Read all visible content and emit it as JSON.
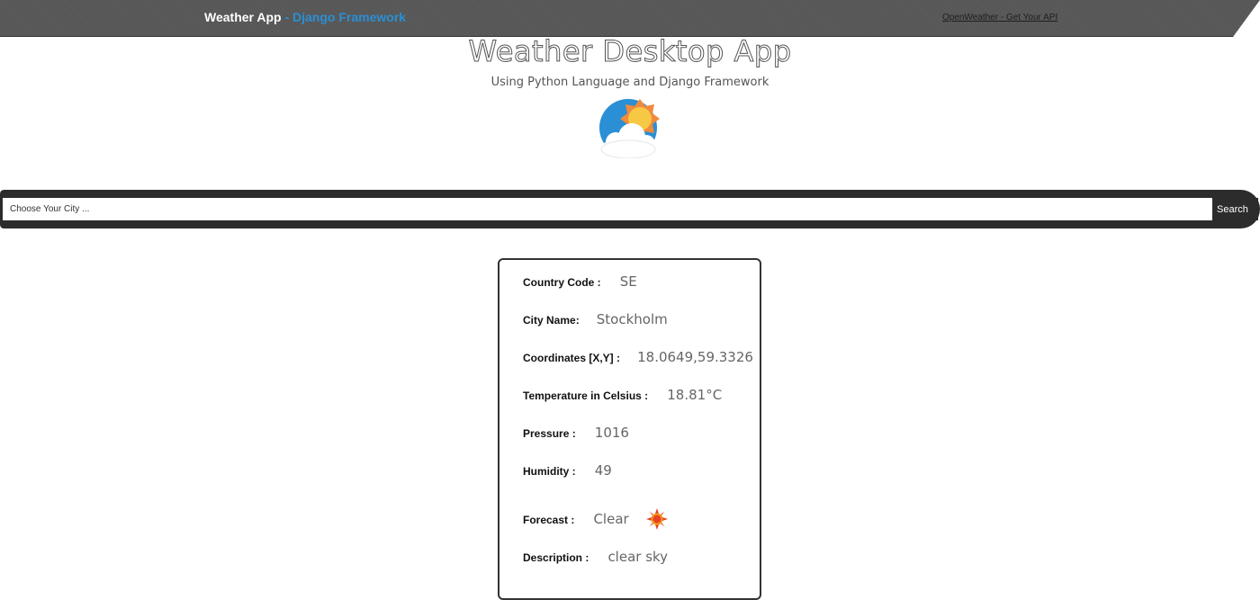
{
  "navbar": {
    "brand": "Weather App",
    "brand_accent": "- Django Framework",
    "api_link": "OpenWeather - Get Your API"
  },
  "header": {
    "title": "Weather Desktop App",
    "subtitle": "Using Python Language and Django Framework",
    "logo_icon": "sun-cloud-icon"
  },
  "search": {
    "placeholder": "Choose Your City ...",
    "value": "",
    "button_label": "Search"
  },
  "weather": {
    "country_code_label": "Country Code :",
    "country_code": "SE",
    "city_name_label": "City Name:",
    "city_name": "Stockholm",
    "coordinates_label": "Coordinates [X,Y] :",
    "coordinates": "18.0649,59.3326",
    "temperature_label": "Temperature in Celsius :",
    "temperature": "18.81°C",
    "pressure_label": "Pressure :",
    "pressure": "1016",
    "humidity_label": "Humidity :",
    "humidity": "49",
    "forecast_label": "Forecast :",
    "forecast": "Clear",
    "forecast_icon": "sun-icon",
    "description_label": "Description :",
    "description": "clear sky"
  },
  "colors": {
    "navbar": "#565656",
    "accent": "#2a8fd4",
    "search_bar": "#2c2c2c"
  }
}
